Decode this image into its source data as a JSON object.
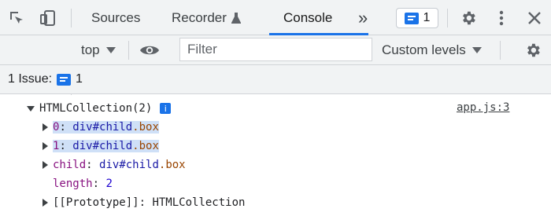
{
  "tabs": {
    "sources": "Sources",
    "recorder": "Recorder",
    "console": "Console",
    "more": "»",
    "issue_badge_count": "1"
  },
  "toolbar": {
    "context": "top",
    "filter_placeholder": "Filter",
    "levels": "Custom levels"
  },
  "issues": {
    "label": "1 Issue:",
    "count": "1"
  },
  "console": {
    "source_link": "app.js:3",
    "object_title": "HTMLCollection(2)",
    "info": "i",
    "items": [
      {
        "key": "0",
        "tag": "div",
        "id": "#child",
        "cls": ".box"
      },
      {
        "key": "1",
        "tag": "div",
        "id": "#child",
        "cls": ".box"
      },
      {
        "key": "child",
        "tag": "div",
        "id": "#child",
        "cls": ".box"
      }
    ],
    "length_key": "length",
    "length_value": "2",
    "prototype_key": "[[Prototype]]",
    "prototype_value": "HTMLCollection"
  }
}
